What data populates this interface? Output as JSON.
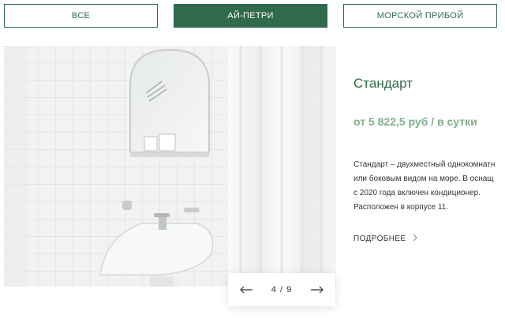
{
  "tabs": [
    {
      "label": "ВСЕ",
      "active": false
    },
    {
      "label": "АЙ-ПЕТРИ",
      "active": true
    },
    {
      "label": "МОРСКОЙ ПРИБОЙ",
      "active": false
    }
  ],
  "room": {
    "title": "Стандарт",
    "price": "от 5 822,5  руб / в сутки",
    "description_lines": [
      "Стандарт – двухместный однокомнатн",
      "или боковым видом на море. В оснащ",
      "с 2020 года включен кондиционер.",
      "Расположен в корпусе 11."
    ],
    "more_label": "ПОДРОБНЕЕ"
  },
  "gallery": {
    "counter": "4 / 9",
    "current": 4,
    "total": 9
  },
  "colors": {
    "brand": "#2f6a4c",
    "price": "#7fb08a"
  },
  "icons": {
    "prev": "arrow-left-icon",
    "next": "arrow-right-icon",
    "more": "chevron-right-icon"
  }
}
